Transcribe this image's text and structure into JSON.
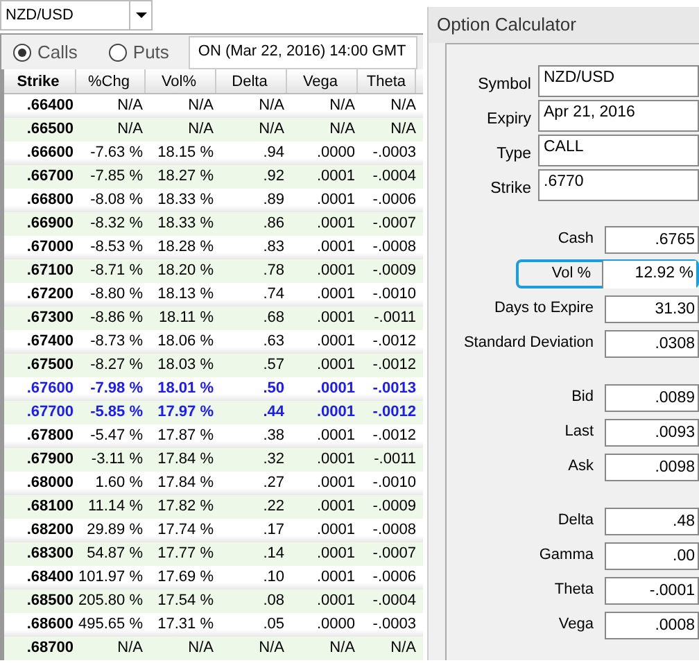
{
  "symbol_select": {
    "value": "NZD/USD"
  },
  "option_type": [
    {
      "label": "Calls",
      "selected": true
    },
    {
      "label": "Puts",
      "selected": false
    }
  ],
  "expiry_label": "ON (Mar 22, 2016) 14:00 GMT",
  "table": {
    "columns": [
      "Strike",
      "%Chg",
      "Vol%",
      "Delta",
      "Vega",
      "Theta"
    ],
    "rows": [
      {
        "highlighted": false,
        "cells": [
          ".66400",
          "N/A",
          "N/A",
          "N/A",
          "N/A",
          "N/A"
        ]
      },
      {
        "highlighted": false,
        "cells": [
          ".66500",
          "N/A",
          "N/A",
          "N/A",
          "N/A",
          "N/A"
        ]
      },
      {
        "highlighted": false,
        "cells": [
          ".66600",
          "-7.63 %",
          "18.15 %",
          ".94",
          ".0000",
          "-.0003"
        ]
      },
      {
        "highlighted": false,
        "cells": [
          ".66700",
          "-7.85 %",
          "18.27 %",
          ".92",
          ".0001",
          "-.0004"
        ]
      },
      {
        "highlighted": false,
        "cells": [
          ".66800",
          "-8.08 %",
          "18.33 %",
          ".89",
          ".0001",
          "-.0006"
        ]
      },
      {
        "highlighted": false,
        "cells": [
          ".66900",
          "-8.32 %",
          "18.33 %",
          ".86",
          ".0001",
          "-.0007"
        ]
      },
      {
        "highlighted": false,
        "cells": [
          ".67000",
          "-8.53 %",
          "18.28 %",
          ".83",
          ".0001",
          "-.0008"
        ]
      },
      {
        "highlighted": false,
        "cells": [
          ".67100",
          "-8.71 %",
          "18.20 %",
          ".78",
          ".0001",
          "-.0009"
        ]
      },
      {
        "highlighted": false,
        "cells": [
          ".67200",
          "-8.80 %",
          "18.13 %",
          ".74",
          ".0001",
          "-.0010"
        ]
      },
      {
        "highlighted": false,
        "cells": [
          ".67300",
          "-8.86 %",
          "18.11 %",
          ".68",
          ".0001",
          "-.0011"
        ]
      },
      {
        "highlighted": false,
        "cells": [
          ".67400",
          "-8.73 %",
          "18.06 %",
          ".63",
          ".0001",
          "-.0012"
        ]
      },
      {
        "highlighted": false,
        "cells": [
          ".67500",
          "-8.27 %",
          "18.03 %",
          ".57",
          ".0001",
          "-.0012"
        ]
      },
      {
        "highlighted": true,
        "cells": [
          ".67600",
          "-7.98 %",
          "18.01 %",
          ".50",
          ".0001",
          "-.0013"
        ]
      },
      {
        "highlighted": true,
        "cells": [
          ".67700",
          "-5.85 %",
          "17.97 %",
          ".44",
          ".0001",
          "-.0012"
        ]
      },
      {
        "highlighted": false,
        "cells": [
          ".67800",
          "-5.47 %",
          "17.87 %",
          ".38",
          ".0001",
          "-.0012"
        ]
      },
      {
        "highlighted": false,
        "cells": [
          ".67900",
          "-3.11 %",
          "17.84 %",
          ".32",
          ".0001",
          "-.0011"
        ]
      },
      {
        "highlighted": false,
        "cells": [
          ".68000",
          "1.60 %",
          "17.84 %",
          ".27",
          ".0001",
          "-.0010"
        ]
      },
      {
        "highlighted": false,
        "cells": [
          ".68100",
          "11.14 %",
          "17.82 %",
          ".22",
          ".0001",
          "-.0009"
        ]
      },
      {
        "highlighted": false,
        "cells": [
          ".68200",
          "29.89 %",
          "17.74 %",
          ".17",
          ".0001",
          "-.0008"
        ]
      },
      {
        "highlighted": false,
        "cells": [
          ".68300",
          "54.87 %",
          "17.77 %",
          ".14",
          ".0001",
          "-.0007"
        ]
      },
      {
        "highlighted": false,
        "cells": [
          ".68400",
          "101.97 %",
          "17.69 %",
          ".10",
          ".0001",
          "-.0006"
        ]
      },
      {
        "highlighted": false,
        "cells": [
          ".68500",
          "205.80 %",
          "17.54 %",
          ".08",
          ".0001",
          "-.0004"
        ]
      },
      {
        "highlighted": false,
        "cells": [
          ".68600",
          "495.65 %",
          "17.31 %",
          ".05",
          ".0000",
          "-.0003"
        ]
      },
      {
        "highlighted": false,
        "cells": [
          ".68700",
          "N/A",
          "N/A",
          "N/A",
          "N/A",
          "N/A"
        ]
      }
    ]
  },
  "calculator": {
    "title": "Option Calculator",
    "selectors": [
      {
        "label": "Symbol",
        "value": "NZD/USD"
      },
      {
        "label": "Expiry",
        "value": "Apr 21, 2016"
      },
      {
        "label": "Type",
        "value": "CALL"
      },
      {
        "label": "Strike",
        "value": ".6770"
      }
    ],
    "groups": [
      [
        {
          "label": "Cash",
          "value": ".6765",
          "focused": false
        },
        {
          "label": "Vol %",
          "value": "12.92 %",
          "focused": true
        },
        {
          "label": "Days to Expire",
          "value": "31.30",
          "focused": false
        },
        {
          "label": "Standard Deviation",
          "value": ".0308",
          "focused": false
        }
      ],
      [
        {
          "label": "Bid",
          "value": ".0089",
          "focused": false
        },
        {
          "label": "Last",
          "value": ".0093",
          "focused": false
        },
        {
          "label": "Ask",
          "value": ".0098",
          "focused": false
        }
      ],
      [
        {
          "label": "Delta",
          "value": ".48",
          "focused": false
        },
        {
          "label": "Gamma",
          "value": ".00",
          "focused": false
        },
        {
          "label": "Theta",
          "value": "-.0001",
          "focused": false
        },
        {
          "label": "Vega",
          "value": ".0008",
          "focused": false
        }
      ]
    ]
  }
}
